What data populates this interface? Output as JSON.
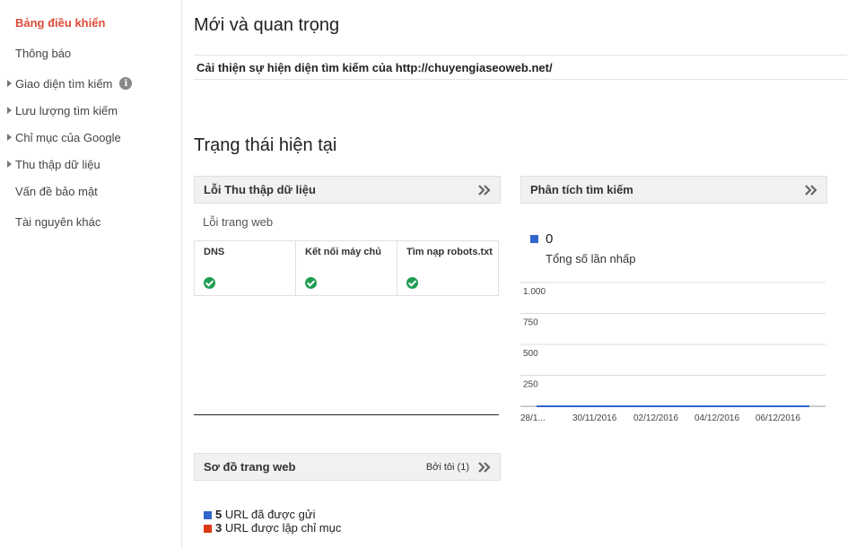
{
  "sidebar": {
    "items": [
      {
        "label": "Bảng điều khiển",
        "active": true,
        "expandable": false
      },
      {
        "label": "Thông báo",
        "active": false,
        "expandable": false
      },
      {
        "label": "Giao diện tìm kiếm",
        "active": false,
        "expandable": true,
        "info": true
      },
      {
        "label": "Lưu lượng tìm kiếm",
        "active": false,
        "expandable": true
      },
      {
        "label": "Chỉ mục của Google",
        "active": false,
        "expandable": true
      },
      {
        "label": "Thu thập dữ liệu",
        "active": false,
        "expandable": true
      },
      {
        "label": "Vấn đề bảo mật",
        "active": false,
        "expandable": false
      },
      {
        "label": "Tài nguyên khác",
        "active": false,
        "expandable": false
      }
    ],
    "info_glyph": "i"
  },
  "main": {
    "new_title": "Mới và quan trọng",
    "notice": "Cải thiện sự hiện diện tìm kiếm của http://chuyengiaseoweb.net/",
    "status_title": "Trạng thái hiện tại"
  },
  "crawl_errors": {
    "title": "Lỗi Thu thập dữ liệu",
    "subtitle": "Lỗi trang web",
    "columns": [
      {
        "label": "DNS",
        "status": "ok"
      },
      {
        "label": "Kết nối máy chủ",
        "status": "ok"
      },
      {
        "label": "Tìm nạp robots.txt",
        "status": "ok"
      }
    ]
  },
  "search_analytics": {
    "title": "Phân tích tìm kiếm",
    "total_clicks": "0",
    "total_clicks_label": "Tổng số lần nhấp",
    "series_color": "#3366cc",
    "chart_data": {
      "type": "line",
      "x": [
        "28/1...",
        "30/11/2016",
        "02/12/2016",
        "04/12/2016",
        "06/12/2016"
      ],
      "y_ticks": [
        "1.000",
        "750",
        "500",
        "250"
      ],
      "ylim": [
        0,
        1000
      ],
      "series": [
        {
          "values": [
            0,
            0,
            0,
            0,
            0
          ]
        }
      ],
      "grid": true
    }
  },
  "sitemaps": {
    "title": "Sơ đồ trang web",
    "by_me": "Bởi tôi (1)",
    "submitted": {
      "count": "5",
      "text": "URL đã được gửi",
      "color": "#3366cc"
    },
    "indexed": {
      "count": "3",
      "text": "URL được lập chỉ mục",
      "color": "#dc3912"
    }
  },
  "colors": {
    "accent": "#dd4b39",
    "ok": "#1e9e52"
  }
}
